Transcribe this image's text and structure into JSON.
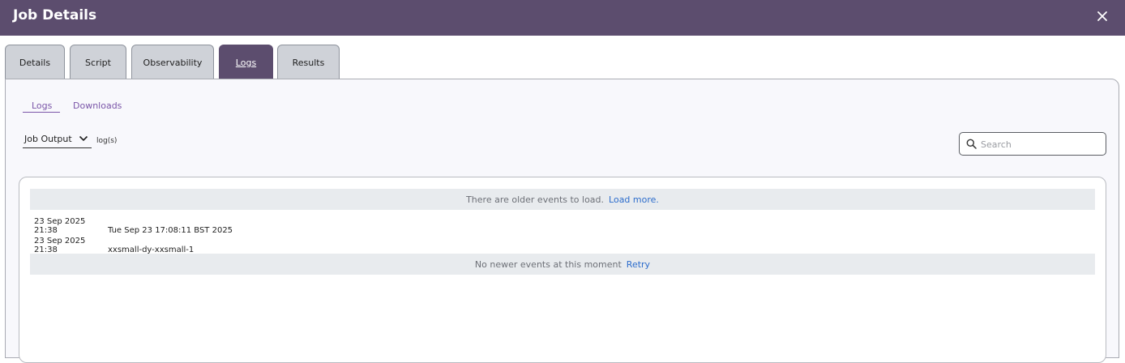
{
  "header": {
    "title": "Job Details",
    "close_icon": "close-icon"
  },
  "tabs": [
    {
      "label": "Details"
    },
    {
      "label": "Script"
    },
    {
      "label": "Observability"
    },
    {
      "label": "Logs",
      "active": true
    },
    {
      "label": "Results"
    }
  ],
  "subtabs": [
    {
      "label": "Logs",
      "active": true
    },
    {
      "label": "Downloads"
    }
  ],
  "log_select": {
    "value": "Job Output",
    "suffix": "log(s)"
  },
  "search": {
    "placeholder": "Search",
    "value": ""
  },
  "log_view": {
    "top_banner": {
      "text": "There are older events to load.",
      "link": "Load more."
    },
    "rows": [
      {
        "timestamp": "23 Sep 2025 21:38",
        "message": "Tue Sep 23 17:08:11 BST 2025"
      },
      {
        "timestamp": "23 Sep 2025 21:38",
        "message": "xxsmall-dy-xxsmall-1"
      }
    ],
    "bottom_banner": {
      "text": "No newer events at this moment",
      "link": "Retry"
    }
  },
  "colors": {
    "header_bg": "#5c4d6e",
    "accent": "#7a55a8",
    "link": "#2d6dcc"
  }
}
